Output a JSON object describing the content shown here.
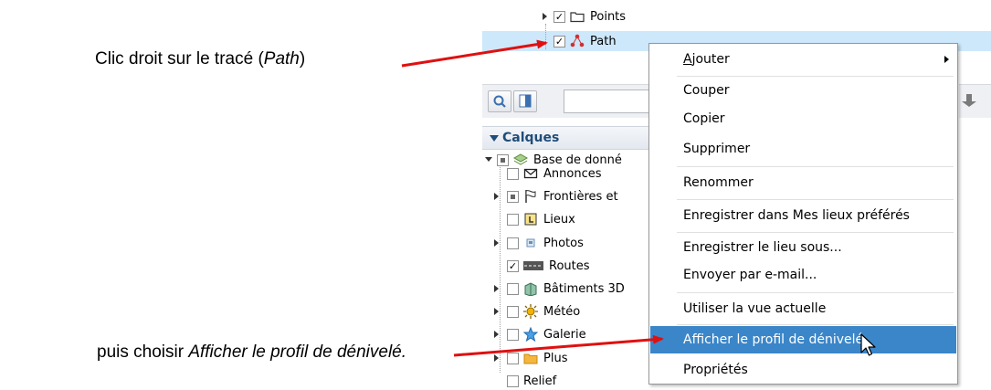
{
  "annotations": {
    "top_prefix": "Clic droit sur le tracé (",
    "top_italic": "Path",
    "top_suffix": ")",
    "bottom_prefix": "puis choisir ",
    "bottom_italic": "Afficher le profil de dénivelé."
  },
  "places": {
    "points_label": "Points",
    "path_label": "Path"
  },
  "layers_panel": {
    "title": "Calques",
    "root": "Base de donné",
    "items": [
      {
        "label": "Annonces",
        "checked": false,
        "expandable": false,
        "icon": "envelope-icon"
      },
      {
        "label": "Frontières et",
        "checked": "partial",
        "expandable": true,
        "icon": "flag-icon"
      },
      {
        "label": "Lieux",
        "checked": false,
        "expandable": false,
        "icon": "place-icon"
      },
      {
        "label": "Photos",
        "checked": false,
        "expandable": true,
        "icon": "photo-icon"
      },
      {
        "label": "Routes",
        "checked": true,
        "expandable": false,
        "icon": "road-icon"
      },
      {
        "label": "Bâtiments 3D",
        "checked": false,
        "expandable": true,
        "icon": "building-icon"
      },
      {
        "label": "Météo",
        "checked": false,
        "expandable": true,
        "icon": "sun-icon"
      },
      {
        "label": "Galerie",
        "checked": false,
        "expandable": true,
        "icon": "star-icon"
      },
      {
        "label": "Plus",
        "checked": false,
        "expandable": true,
        "icon": "folder-icon"
      },
      {
        "label": "Relief",
        "checked": false,
        "expandable": false,
        "icon": ""
      }
    ]
  },
  "context_menu": {
    "items": [
      {
        "label": "Ajouter",
        "submenu": true
      },
      {
        "label": "Couper"
      },
      {
        "label": "Copier"
      },
      {
        "label": "Supprimer"
      },
      {
        "label": "Renommer"
      },
      {
        "label": "Enregistrer dans Mes lieux préférés"
      },
      {
        "label": "Enregistrer le lieu sous..."
      },
      {
        "label": "Envoyer par e-mail..."
      },
      {
        "label": "Utiliser la vue actuelle"
      },
      {
        "label": "Afficher le profil de dénivelé",
        "highlighted": true
      },
      {
        "label": "Propriétés"
      }
    ]
  },
  "colors": {
    "arrow": "#e01010",
    "selection": "#cde8fb",
    "menu_highlight": "#3b86c9",
    "panel_title": "#1f4d7a"
  }
}
